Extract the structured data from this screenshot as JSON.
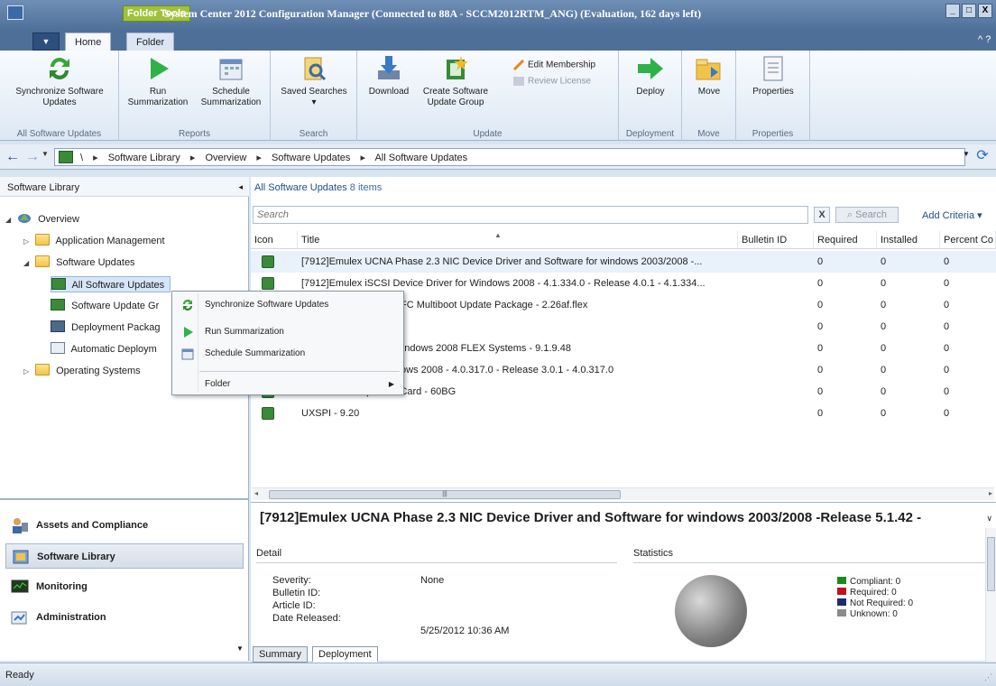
{
  "window": {
    "context_tab": "Folder Tools",
    "title": "System Center 2012 Configuration Manager (Connected to 88A - SCCM2012RTM_ANG) (Evaluation, 162 days left)",
    "minimize": "_",
    "maximize": "□",
    "close": "X",
    "help": "?"
  },
  "ribbon_tabs": [
    {
      "label": "Home"
    },
    {
      "label": "Folder"
    }
  ],
  "ribbon": {
    "groups": [
      {
        "label": "All Software Updates",
        "buttons": [
          {
            "label": "Synchronize Software Updates",
            "icon": "sync-icon"
          }
        ]
      },
      {
        "label": "Reports",
        "buttons": [
          {
            "label": "Run Summarization",
            "icon": "run-icon"
          },
          {
            "label": "Schedule Summarization",
            "icon": "calendar-icon"
          }
        ]
      },
      {
        "label": "Search",
        "buttons": [
          {
            "label": "Saved Searches ▾",
            "icon": "saved-search-icon"
          }
        ]
      },
      {
        "label": "Update",
        "buttons": [
          {
            "label": "Download",
            "icon": "download-icon"
          },
          {
            "label": "Create Software Update Group",
            "icon": "create-group-icon"
          }
        ],
        "small": [
          {
            "label": "Edit Membership"
          },
          {
            "label": "Review License"
          }
        ]
      },
      {
        "label": "Deployment",
        "buttons": [
          {
            "label": "Deploy",
            "icon": "deploy-icon"
          }
        ]
      },
      {
        "label": "Move",
        "buttons": [
          {
            "label": "Move",
            "icon": "move-icon"
          }
        ]
      },
      {
        "label": "Properties",
        "buttons": [
          {
            "label": "Properties",
            "icon": "properties-icon"
          }
        ]
      }
    ]
  },
  "address_bar": {
    "root": "\\",
    "crumbs": [
      "Software Library",
      "Overview",
      "Software Updates",
      "All Software Updates"
    ],
    "separator": "▸"
  },
  "left_pane": {
    "title": "Software Library",
    "tree": [
      {
        "label": "Overview"
      },
      {
        "label": "Application Management"
      },
      {
        "label": "Software Updates"
      },
      {
        "label": "All Software Updates"
      },
      {
        "label": "Software Update Gr"
      },
      {
        "label": "Deployment Packag"
      },
      {
        "label": "Automatic Deploym"
      },
      {
        "label": "Operating Systems"
      }
    ],
    "workspaces": [
      {
        "label": "Assets and Compliance"
      },
      {
        "label": "Software Library"
      },
      {
        "label": "Monitoring"
      },
      {
        "label": "Administration"
      }
    ]
  },
  "main": {
    "header": "All Software Updates",
    "count": "8 items",
    "search_placeholder": "Search",
    "search_button": "Search",
    "clear": "X",
    "add_criteria": "Add Criteria ▾",
    "columns": [
      "Icon",
      "Title",
      "Bulletin ID",
      "Required",
      "Installed",
      "Percent Co"
    ],
    "rows": [
      {
        "title": "[7912]Emulex UCNA Phase 2.3 NIC Device Driver and Software for windows 2003/2008 -...",
        "bulletin": "",
        "required": "0",
        "installed": "0",
        "percent": "0"
      },
      {
        "title": "[7912]Emulex iSCSI Device Driver for Windows 2008 - 4.1.334.0 - Release 4.0.1 - 4.1.334...",
        "bulletin": "",
        "required": "0",
        "installed": "0",
        "percent": "0"
      },
      {
        "title": "m FC3172 2-port 8Gb FC Multiboot Update Package - 2.26af.flex",
        "bulletin": "",
        "required": "0",
        "installed": "0",
        "percent": "0"
      },
      {
        "title": "Update - 1.00",
        "bulletin": "",
        "required": "0",
        "installed": "0",
        "percent": "0"
      },
      {
        "title": "R Device Drivers for Windows 2008 FLEX Systems - 9.1.9.48",
        "bulletin": "",
        "required": "0",
        "installed": "0",
        "percent": "0"
      },
      {
        "title": "Device Driver for Windows 2008 - 4.0.317.0 - Release 3.0.1 - 4.0.317.0",
        "bulletin": "",
        "required": "0",
        "installed": "0",
        "percent": "0"
      },
      {
        "title": "Series SAS Expander Card - 60BG",
        "bulletin": "",
        "required": "0",
        "installed": "0",
        "percent": "0"
      },
      {
        "title": "UXSPI - 9.20",
        "bulletin": "",
        "required": "0",
        "installed": "0",
        "percent": "0"
      }
    ]
  },
  "details": {
    "title": "[7912]Emulex UCNA Phase 2.3 NIC Device Driver and Software for windows 2003/2008 -Release 5.1.42 -",
    "detail_heading": "Detail",
    "stats_heading": "Statistics",
    "fields": [
      {
        "label": "Severity:",
        "value": "None"
      },
      {
        "label": "Bulletin ID:",
        "value": ""
      },
      {
        "label": "Article ID:",
        "value": ""
      },
      {
        "label": "Date Released:",
        "value": "5/25/2012 10:36 AM"
      }
    ],
    "legend": [
      {
        "label": "Compliant: 0",
        "color": "#1a8a1a"
      },
      {
        "label": "Required: 0",
        "color": "#c0141c"
      },
      {
        "label": "Not Required: 0",
        "color": "#1a2a7a"
      },
      {
        "label": "Unknown: 0",
        "color": "#8a8a8a"
      }
    ],
    "tabs": [
      "Summary",
      "Deployment"
    ]
  },
  "context_menu": {
    "items": [
      {
        "label": "Synchronize Software Updates",
        "icon": "sync-icon"
      },
      {
        "label": "Run Summarization",
        "icon": "run-icon"
      },
      {
        "label": "Schedule Summarization",
        "icon": "calendar-icon"
      },
      {
        "label": "Folder",
        "icon": ""
      }
    ]
  },
  "status": "Ready"
}
